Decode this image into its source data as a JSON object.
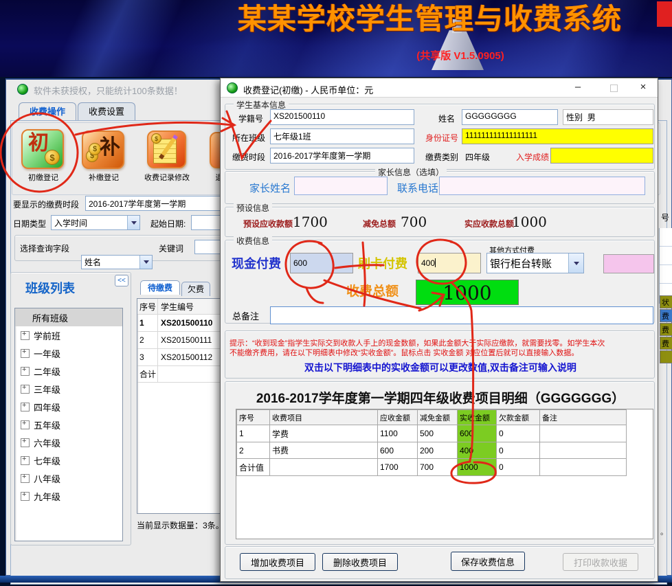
{
  "banner": {
    "title": "某某学校学生管理与收费系统",
    "version": "(共享版  V1.5.0905)"
  },
  "main_window": {
    "titlebar_text": "软件未获授权，只能统计100条数据！",
    "tabs": [
      {
        "label": "收费操作"
      },
      {
        "label": "收费设置"
      }
    ],
    "toolbar": [
      {
        "label": "初缴登记",
        "glyph": "初"
      },
      {
        "label": "补缴登记",
        "glyph": "补"
      },
      {
        "label": "收费记录修改",
        "glyph": ""
      },
      {
        "label": "退",
        "glyph": ""
      }
    ],
    "filters": {
      "period_label": "要显示的缴费时段",
      "period_value": "2016-2017学年度第一学期",
      "date_type_label": "日期类型",
      "date_type_value": "入学时间",
      "start_date_label": "起始日期:",
      "query_field_label": "选择查询字段",
      "query_field_value": "姓名",
      "keyword_label": "关键词"
    },
    "class_panel": {
      "title": "班级列表",
      "collapse_label": "<<",
      "items": [
        "所有班级",
        "学前班",
        "一年级",
        "二年级",
        "三年级",
        "四年级",
        "五年级",
        "六年级",
        "七年级",
        "八年级",
        "九年级"
      ]
    },
    "student_list": {
      "tabs": [
        "待缴费",
        "欠费"
      ],
      "headers": [
        "序号",
        "学生编号"
      ],
      "rows": [
        [
          "1",
          "XS201500110"
        ],
        [
          "2",
          "XS201500111"
        ],
        [
          "3",
          "XS201500112"
        ]
      ],
      "total_label": "合计",
      "status": "当前显示数据量：3条。"
    },
    "right_strip": {
      "header_fragment": "号",
      "cells": [
        "状",
        "费",
        "费",
        "费",
        ""
      ],
      "bottom_fragment": "。"
    }
  },
  "dialog": {
    "title": "收费登记(初缴) - 人民币单位：元",
    "window_buttons": {
      "minimize": "–",
      "close": "×"
    },
    "student_info": {
      "group_label": "学生基本信息",
      "fields": {
        "student_id_label": "学籍号",
        "student_id": "XS201500110",
        "name_label": "姓名",
        "name": "GGGGGGGG",
        "gender_label": "性别",
        "gender": "男",
        "class_label": "所在班级",
        "class": "七年级1班",
        "id_number_label": "身份证号",
        "id_number": "111111111111111111",
        "period_label": "缴费时段",
        "period": "2016-2017学年度第一学期",
        "fee_type_label": "缴费类别",
        "fee_type": "四年级",
        "entry_score_label": "入学成绩",
        "entry_score": ""
      }
    },
    "parent_info": {
      "group_label": "家长信息（选填）",
      "parent_name_label": "家长姓名",
      "parent_name": "",
      "phone_label": "联系电话",
      "phone": ""
    },
    "preset_info": {
      "group_label": "预设信息",
      "preset_due_label": "预设应收款额",
      "preset_due": "1700",
      "discount_label": "减免总额",
      "discount": "700",
      "actual_due_label": "实应收款总额",
      "actual_due": "1000"
    },
    "payment_info": {
      "group_label": "收费信息",
      "cash_label": "现金付费",
      "cash": "600",
      "card_label": "刷卡付费",
      "card": "400",
      "other_label": "其他方式付费",
      "other_method": "银行柜台转账",
      "total_label": "收费总额",
      "total": "1000",
      "remark_label": "总备注",
      "remark": ""
    },
    "hint": {
      "red_line1": "提示：“收到现金”指学生实际交到收款人手上的现金数额，如果此金额大于实际应缴款，就需要找零。如学生本次",
      "red_line2": "不能缴齐费用，请在以下明细表中修改“实收金额”。鼠标点击 实收金额 对应位置后就可以直接输入数据。",
      "blue_line": "双击以下明细表中的实收金额可以更改数值,双击备注可输入说明"
    },
    "detail_table": {
      "title": "2016-2017学年度第一学期四年级收费项目明细（GGGGGGG）",
      "headers": [
        "序号",
        "收费项目",
        "应收金额",
        "减免金额",
        "实收金额",
        "欠款金额",
        "备注"
      ],
      "rows": [
        [
          "1",
          "学费",
          "1100",
          "500",
          "600",
          "0",
          ""
        ],
        [
          "2",
          "书费",
          "600",
          "200",
          "400",
          "0",
          ""
        ],
        [
          "合计值",
          "",
          "1700",
          "700",
          "1000",
          "0",
          ""
        ]
      ]
    },
    "buttons": {
      "add": "增加收费项目",
      "delete": "删除收费项目",
      "save": "保存收费信息",
      "print": "打印收款收据"
    }
  },
  "colors": {
    "accent_green": "#00dd10",
    "cell_green": "#7ccc22",
    "highlight_yellow": "#ffff00",
    "annotation_red": "#e02818",
    "banner_title_orange": "#ff9200",
    "banner_version_red": "#ff2020"
  }
}
